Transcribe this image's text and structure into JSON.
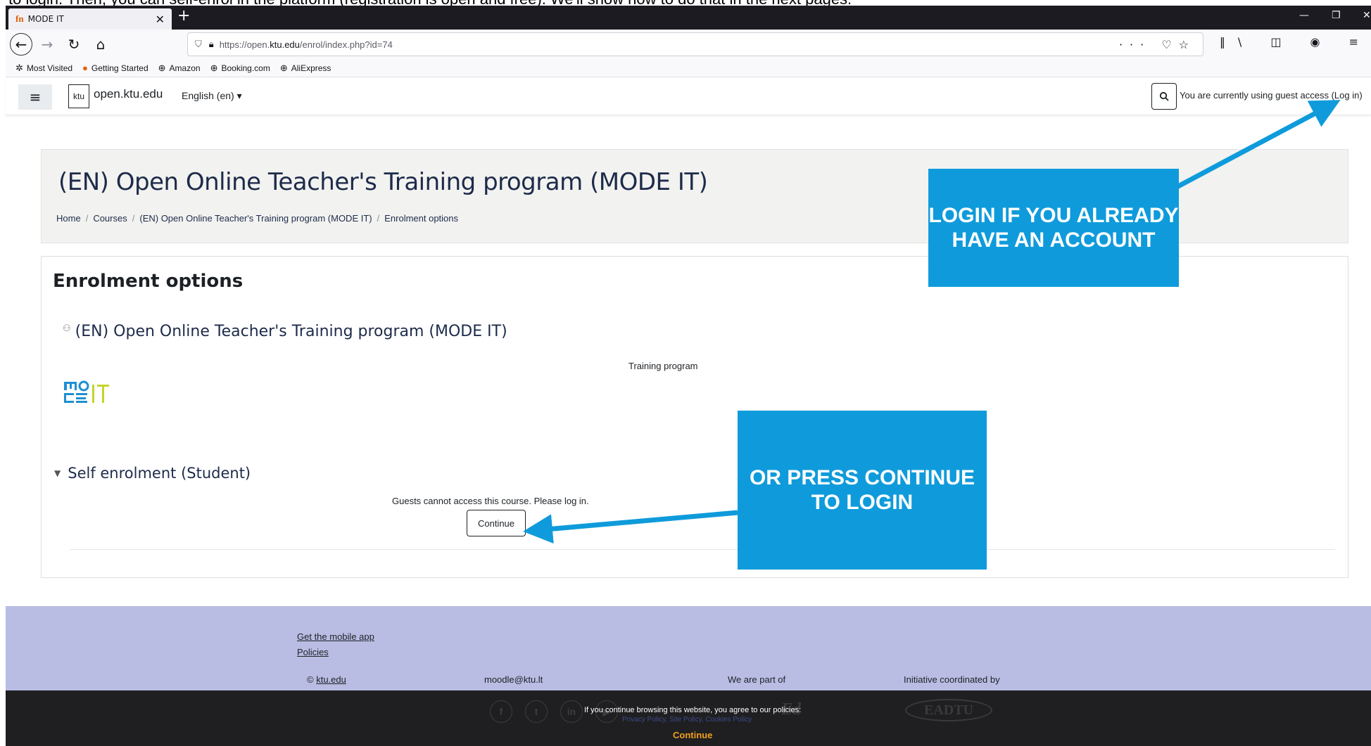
{
  "caption": "to login. Then, you can self-enrol in the platform (registration is open and free). We'll show how to do that in the next pages.",
  "browser": {
    "tab_title": "MODE IT",
    "tab_favicon": "fn",
    "url_host": "https://open.",
    "url_domain": "ktu.edu",
    "url_path": "/enrol/index.php?id=74",
    "bookmarks": [
      {
        "icon": "gear-icon",
        "label": "Most Visited"
      },
      {
        "icon": "firefox-icon",
        "label": "Getting Started"
      },
      {
        "icon": "globe-icon",
        "label": "Amazon"
      },
      {
        "icon": "globe-icon",
        "label": "Booking.com"
      },
      {
        "icon": "globe-icon",
        "label": "AliExpress"
      }
    ]
  },
  "header": {
    "logo_text": "ktu",
    "site_name": "open.ktu.edu",
    "language": "English (en)",
    "guest_text": "You are currently using guest access (",
    "login_link": "Log in",
    "guest_text_end": ")"
  },
  "page": {
    "title": "(EN) Open Online Teacher's Training program (MODE IT)",
    "breadcrumbs": [
      "Home",
      "Courses",
      "(EN) Open Online Teacher's Training program (MODE IT)",
      "Enrolment options"
    ]
  },
  "main": {
    "section_title": "Enrolment options",
    "course_name": "(EN) Open Online Teacher's Training program (MODE IT)",
    "summary": "Training program",
    "self_enrol_title": "Self enrolment (Student)",
    "guest_message": "Guests cannot access this course. Please log in.",
    "continue_label": "Continue"
  },
  "footer": {
    "mobile_app": "Get the mobile app",
    "policies": "Policies",
    "copyright": "© ",
    "copyright_link": "ktu.edu",
    "email": "moodle@ktu.lt",
    "we_are_part_of": "We are part of",
    "initiative": "Initiative coordinated by",
    "cookie_message": "If you continue browsing this website, you agree to our policies:",
    "cookie_links": "Privacy Policy, Site Policy, Cookies Policy",
    "cookie_continue": "Continue",
    "partner_logo": "Ed",
    "eadtu_logo": "EADTU"
  },
  "annotations": {
    "callout_login": "LOGIN IF YOU ALREADY HAVE AN ACCOUNT",
    "callout_continue": "OR PRESS CONTINUE TO LOGIN",
    "color": "#0f9bdb"
  }
}
